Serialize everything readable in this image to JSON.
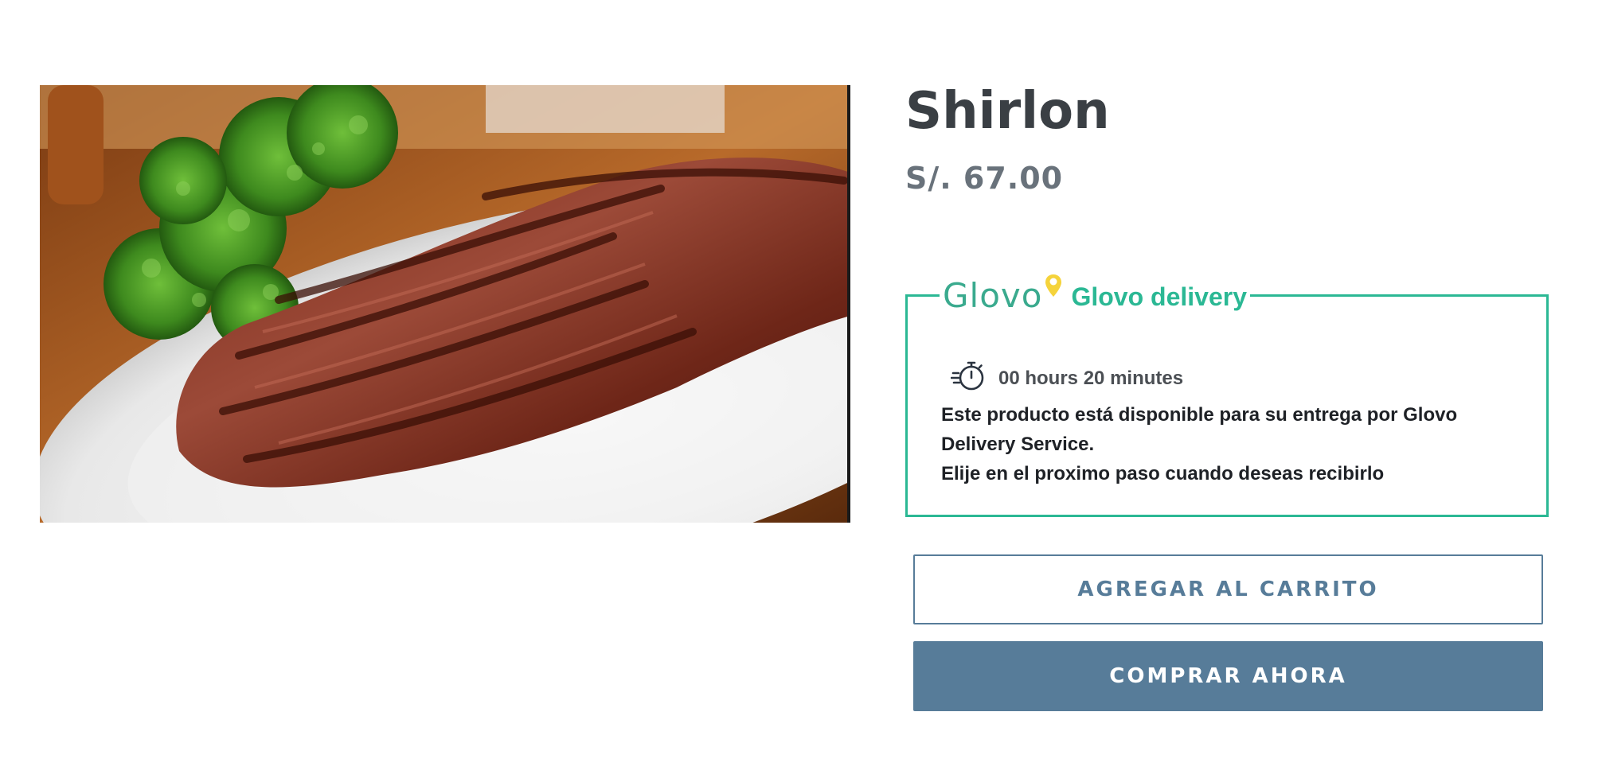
{
  "product": {
    "title": "Shirlon",
    "price": "S/. 67.00",
    "image_alt": "Grilled steak with parsley on a white plate"
  },
  "glovo": {
    "logo_text": "Glovo",
    "title": "Glovo delivery",
    "time_icon": "stopwatch-icon",
    "time": "00 hours 20 minutes",
    "line1": "Este producto está disponible para su entrega por Glovo Delivery Service.",
    "line2": "Elije en el proximo paso cuando deseas recibirlo"
  },
  "buttons": {
    "add_to_cart": "AGREGAR AL CARRITO",
    "buy_now": "COMPRAR AHORA"
  },
  "colors": {
    "glovo_accent": "#2bb894",
    "button_primary": "#577c99",
    "title_text": "#3a3f44",
    "price_text": "#69727b"
  }
}
